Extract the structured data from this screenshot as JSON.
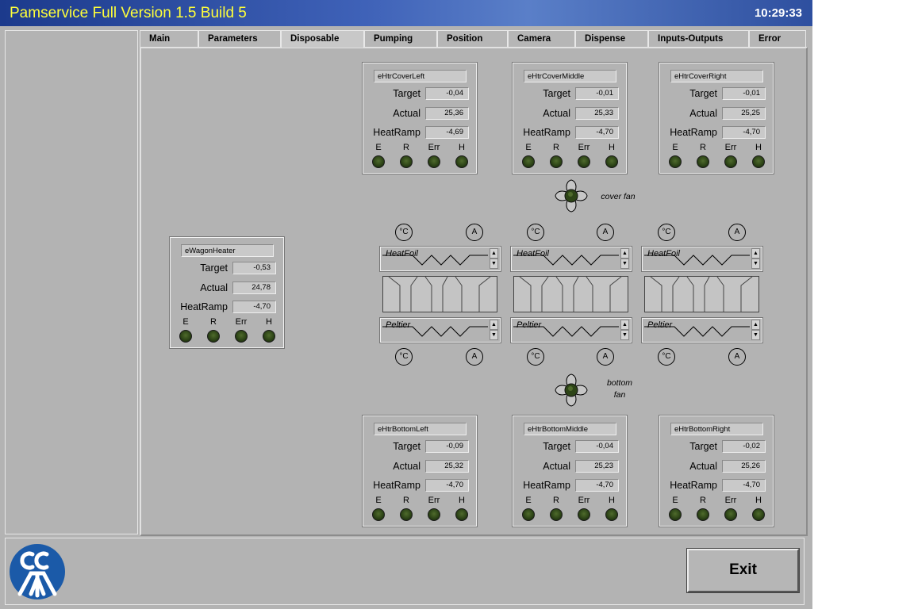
{
  "window": {
    "title": "Pamservice Full Version 1.5 Build 5",
    "clock": "10:29:33"
  },
  "tabs": [
    {
      "label": "Main"
    },
    {
      "label": "Parameters"
    },
    {
      "label": "Disposable"
    },
    {
      "label": "Pumping"
    },
    {
      "label": "Position"
    },
    {
      "label": "Camera"
    },
    {
      "label": "Dispense"
    },
    {
      "label": "Inputs-Outputs"
    },
    {
      "label": "Error"
    }
  ],
  "active_tab": "Disposable",
  "labels": {
    "target": "Target",
    "actual": "Actual",
    "heatramp": "HeatRamp",
    "led_e": "E",
    "led_r": "R",
    "led_err": "Err",
    "led_h": "H"
  },
  "heaters": {
    "cover_left": {
      "name": "eHtrCoverLeft",
      "target": "-0,04",
      "actual": "25,36",
      "heatramp": "-4,69"
    },
    "cover_middle": {
      "name": "eHtrCoverMiddle",
      "target": "-0,01",
      "actual": "25,33",
      "heatramp": "-4,70"
    },
    "cover_right": {
      "name": "eHtrCoverRight",
      "target": "-0,01",
      "actual": "25,25",
      "heatramp": "-4,70"
    },
    "wagon": {
      "name": "eWagonHeater",
      "target": "-0,53",
      "actual": "24,78",
      "heatramp": "-4,70"
    },
    "bottom_left": {
      "name": "eHtrBottomLeft",
      "target": "-0,09",
      "actual": "25,32",
      "heatramp": "-4,70"
    },
    "bottom_middle": {
      "name": "eHtrBottomMiddle",
      "target": "-0,04",
      "actual": "25,23",
      "heatramp": "-4,70"
    },
    "bottom_right": {
      "name": "eHtrBottomRight",
      "target": "-0,02",
      "actual": "25,26",
      "heatramp": "-4,70"
    }
  },
  "foils": {
    "heatfoil_label": "HeatFoil",
    "peltier_label": "Peltier",
    "celsius": "°C",
    "ampere": "A"
  },
  "fans": {
    "cover_label": "cover fan",
    "bottom_label_1": "bottom",
    "bottom_label_2": "fan"
  },
  "footer": {
    "exit_label": "Exit"
  },
  "colors": {
    "title_text": "#ffff3a",
    "led_off": "#2d4417",
    "panel_bg": "#b3b3b3"
  }
}
